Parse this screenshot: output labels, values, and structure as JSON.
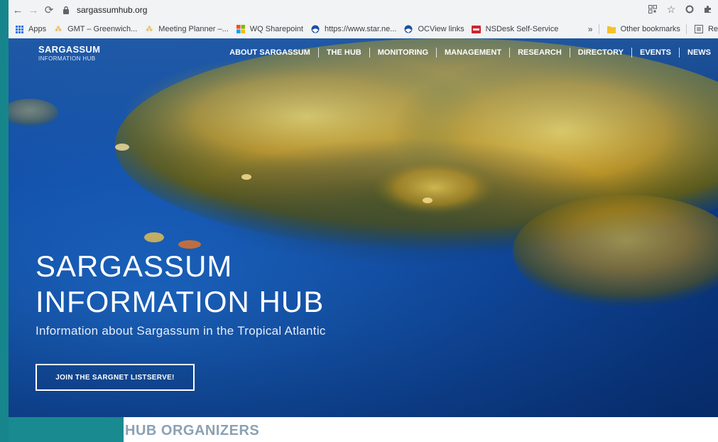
{
  "browser": {
    "url": "sargassumhub.org",
    "bookmarks": [
      {
        "label": "Apps"
      },
      {
        "label": "GMT – Greenwich..."
      },
      {
        "label": "Meeting Planner –..."
      },
      {
        "label": "WQ Sharepoint"
      },
      {
        "label": "https://www.star.ne..."
      },
      {
        "label": "OCView links"
      },
      {
        "label": "NSDesk Self-Service"
      }
    ],
    "overflow": "»",
    "other_bookmarks": "Other bookmarks",
    "reading_list": "Re"
  },
  "site": {
    "logo_line1": "SARGASSUM",
    "logo_line2": "INFORMATION HUB",
    "nav": [
      "ABOUT SARGASSUM",
      "THE HUB",
      "MONITORING",
      "MANAGEMENT",
      "RESEARCH",
      "DIRECTORY",
      "EVENTS",
      "NEWS"
    ]
  },
  "hero": {
    "title_line1": "SARGASSUM",
    "title_line2": "INFORMATION HUB",
    "subtitle": "Information about Sargassum in the Tropical Atlantic",
    "cta_label": "JOIN THE SARGNET LISTSERVE!"
  },
  "organizers": {
    "heading": "HUB ORGANIZERS"
  },
  "colors": {
    "teal_frame": "#1a8a91",
    "sea": "#124fa8",
    "seaweed": "#d6a421"
  }
}
